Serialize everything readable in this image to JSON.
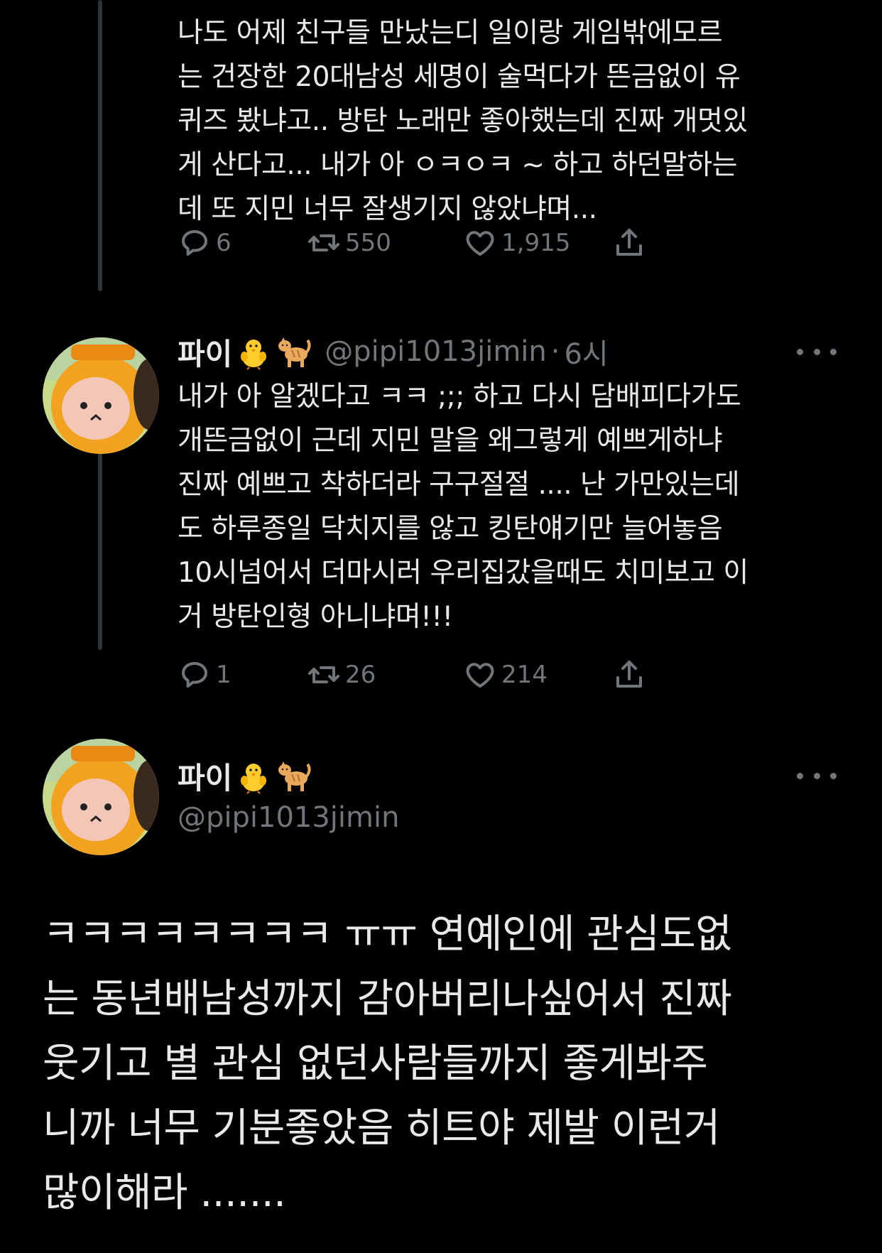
{
  "tweet_prev": {
    "text": "나도 어제 친구들 만났는디 일이랑 게임밖에모르\n는 건장한 20대남성 세명이 술먹다가 뜬금없이 유\n퀴즈 봤냐고.. 방탄 노래만 좋아했는데 진짜 개멋있\n게 산다고... 내가 아 ㅇㅋㅇㅋ ~ 하고 하던말하는\n데 또 지민 너무 잘생기지 않았냐며...",
    "replies": "6",
    "retweets": "550",
    "likes": "1,915"
  },
  "tweet_reply": {
    "name": "파이",
    "handle": "@pipi1013jimin",
    "separator": "·",
    "time": "6시",
    "text": "내가 아 알겠다고 ㅋㅋ ;;; 하고 다시 담배피다가도\n개뜬금없이 근데 지민 말을 왜그렇게 예쁘게하냐\n진짜 예쁘고 착하더라 구구절절 .... 난 가만있는데\n도 하루종일 닥치지를 않고 킹탄얘기만 늘어놓음\n10시넘어서 더마시러 우리집갔을때도 치미보고 이\n거 방탄인형 아니냐며!!!",
    "replies": "1",
    "retweets": "26",
    "likes": "214"
  },
  "tweet_main": {
    "name": "파이",
    "handle": "@pipi1013jimin",
    "text": "ㅋㅋㅋㅋㅋㅋㅋㅋ ㅠㅠ 연예인에 관심도없\n는 동년배남성까지 감아버리나싶어서 진짜\n웃기고 별 관심 없던사람들까지 좋게봐주\n니까 너무 기분좋았음 히트야 제발 이런거\n많이해라 ......."
  },
  "icons": {
    "reply": "reply-icon",
    "retweet": "retweet-icon",
    "like": "heart-icon",
    "share": "share-icon",
    "more": "more-icon",
    "emoji1": "baby-chick-emoji-icon",
    "emoji2": "cat-emoji-icon"
  },
  "colors": {
    "background": "#000000",
    "text": "#e7e9ea",
    "secondary": "#71767b",
    "thread_line": "#2f3336"
  }
}
